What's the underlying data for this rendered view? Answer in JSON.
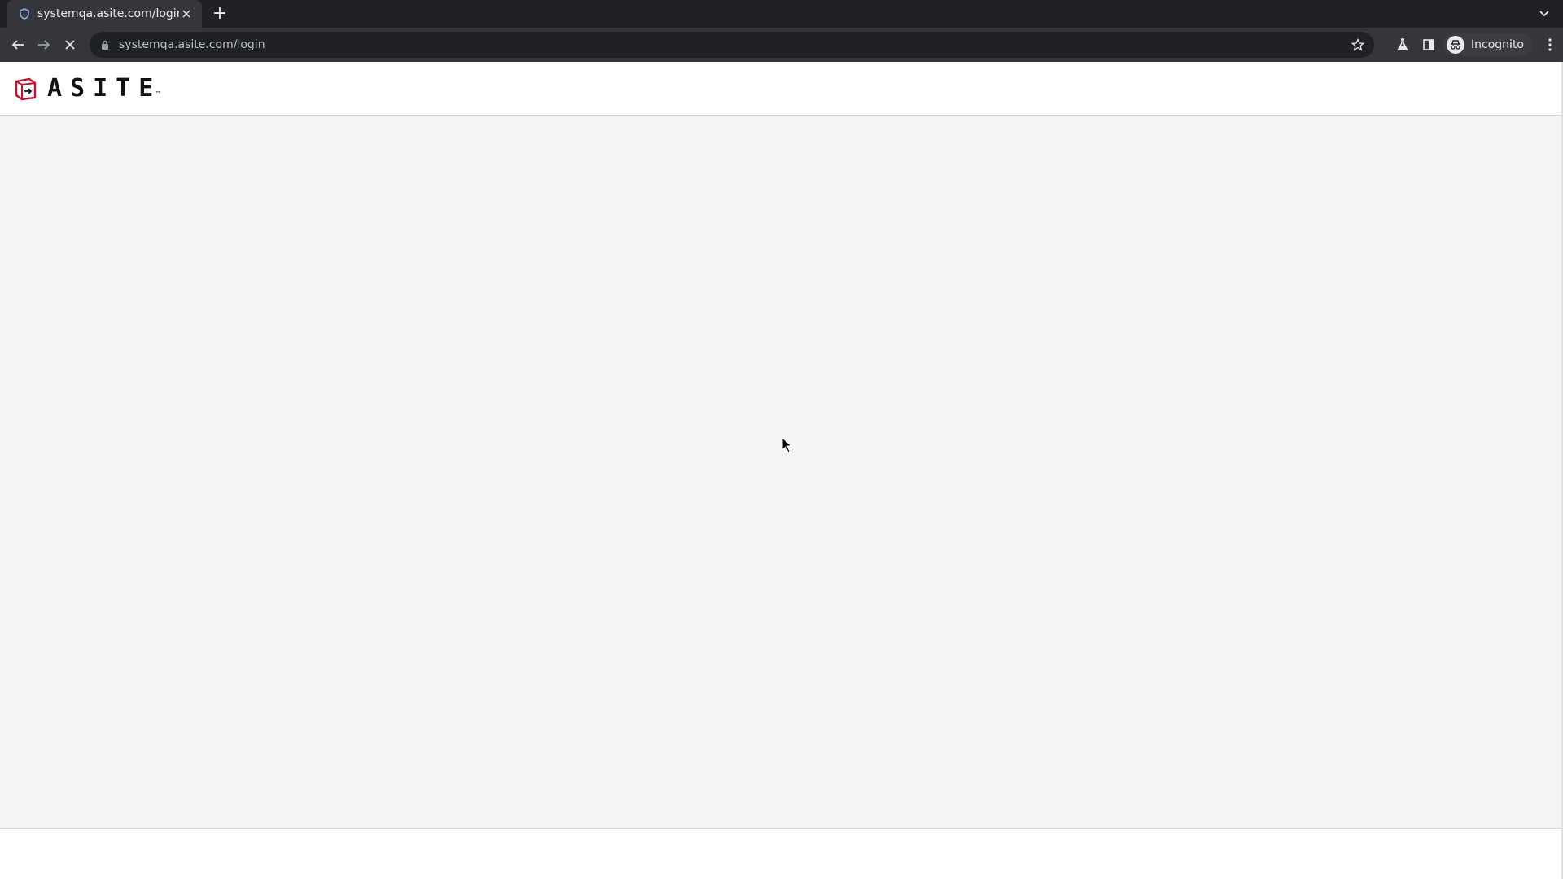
{
  "browser": {
    "tab": {
      "title": "systemqa.asite.com/login"
    },
    "new_tab_label": "+",
    "url": "systemqa.asite.com/login",
    "profile_label": "Incognito",
    "colors": {
      "frame": "#202124",
      "toolbar": "#35363a"
    }
  },
  "page": {
    "brand": {
      "name": "ASITE",
      "trademark": "™",
      "logo_color": "#c8102e"
    },
    "background": "#f4f4f4"
  }
}
